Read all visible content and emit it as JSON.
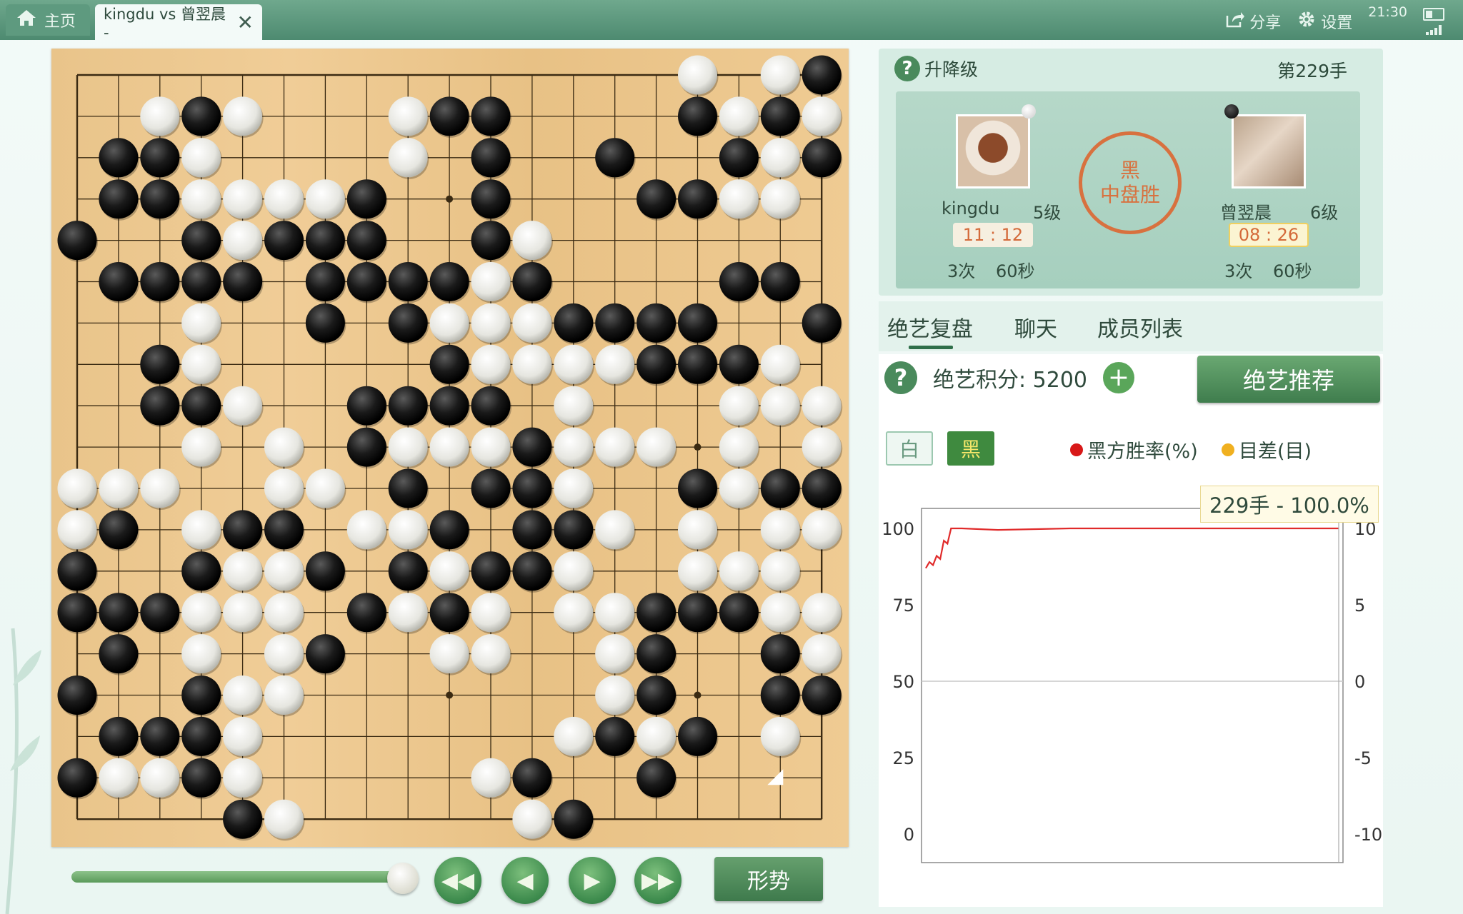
{
  "tabs": {
    "home": "主页",
    "game": "kingdu vs 曾翌晨 -"
  },
  "toolbar": {
    "share": "分享",
    "settings": "设置"
  },
  "status": {
    "time": "21:30"
  },
  "info": {
    "mode": "升降级",
    "move": "第229手",
    "result_line1": "黑",
    "result_line2": "中盘胜"
  },
  "players": {
    "white": {
      "name": "kingdu",
      "level": "5级",
      "time": "11 : 12",
      "byoyomi_count": "3次",
      "byoyomi_time": "60秒"
    },
    "black": {
      "name": "曾翌晨",
      "level": "6级",
      "time": "08 : 26",
      "byoyomi_count": "3次",
      "byoyomi_time": "60秒"
    }
  },
  "panel_tabs": [
    "绝艺复盘",
    "聊天",
    "成员列表"
  ],
  "analysis": {
    "score_label": "绝艺积分: 5200",
    "recommend": "绝艺推荐",
    "toggle_white": "白",
    "toggle_black": "黑",
    "legend_winrate": "黑方胜率(%)",
    "legend_diff": "目差(目)",
    "tooltip": "229手 - 100.0%"
  },
  "controls": {
    "situation": "形势"
  },
  "colors": {
    "winrate_line": "#e02a2a",
    "diff_dot": "#f0b020",
    "accent_green": "#3f7d4d",
    "result_seal": "#d8713f"
  },
  "board": {
    "size": 19,
    "rows": [
      "...............W.WB",
      "..WBW...WBB....BWBWW",
      ".BBW....W.B..B..BWBB",
      ".BBWWWWB..B...BBWW.",
      "B..BWBBB..BW.......",
      ".BBBB.BBBBWB....BB.",
      "...W..B.BWWWBBBB..B",
      "..BW.....BWWWWBBBW.",
      "..BBW..BBBB.W...WWW",
      "...W.W.BWWWBWWW.W.WW",
      "WWW..WW.B.BBW..BWBBBB",
      "WB.WBB.WWB.BBW.W.WW",
      "B..BWWB.BWBBW..WWW.",
      "BBBWWW.BWBW.WWBBBWW",
      ".B.W.WB..WW..WB..BWW",
      "B..BWW.......WB..BBBB",
      ".BBBW.......WBWB.W..",
      "BWWBW.....WB..B....",
      "....BW.....WB......."
    ],
    "last_move": "17-17"
  },
  "chart_data": {
    "type": "line",
    "xlabel": "",
    "ylabel": "",
    "y_left_ticks": [
      100,
      75,
      50,
      25,
      0
    ],
    "y_right_ticks": [
      10,
      5,
      0,
      -5,
      -10
    ],
    "ylim": [
      0,
      100
    ],
    "xlim": [
      0,
      229
    ],
    "series": [
      {
        "name": "黑方胜率(%)",
        "x": [
          0,
          2,
          4,
          6,
          8,
          10,
          12,
          14,
          16,
          20,
          40,
          80,
          120,
          160,
          200,
          229
        ],
        "y": [
          87,
          89,
          88,
          91,
          90,
          96,
          95,
          100,
          100,
          100,
          99.5,
          100,
          100,
          100,
          100,
          100
        ]
      }
    ]
  }
}
